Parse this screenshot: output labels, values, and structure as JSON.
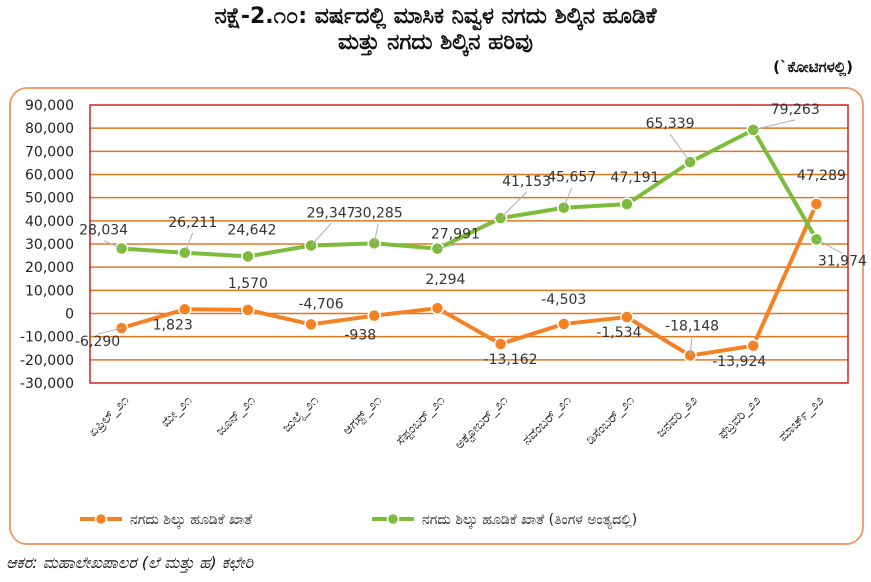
{
  "title_line1": "ನಕ್ಷೆ-2.೧೦: ವರ್ಷದಲ್ಲಿ ಮಾಸಿಕ ನಿವ್ವಳ ನಗದು ಶಿಲ್ಕಿನ ಹೂಡಿಕೆ",
  "title_line2": "ಮತ್ತು ನಗದು ಶಿಲ್ಕಿನ ಹರಿವು",
  "unit_label": "(`ಕೋಟಿಗಳಲ್ಲಿ)",
  "source_note": "ಆಕರ: ಮಹಾಲೇಖಪಾಲರ (ಲೆ ಮತ್ತು ಹ) ಕಛೇರಿ",
  "colors": {
    "series1": "#f48224",
    "series2": "#7dbb3b",
    "grid": "#e07820",
    "plot_border": "#d42020",
    "frame": "#f0a070"
  },
  "chart_data": {
    "type": "line",
    "categories": [
      "ಏಪ್ರಿಲ್_೨೧",
      "ಮೇ_೨೧",
      "ಜೂನ್_೨೧",
      "ಜುಲೈ_೨೧",
      "ಆಗಸ್ಟ್_೨೧",
      "ಸೆಪ್ಟಂಬರ್_೨೧",
      "ಅಕ್ಟೋಬರ್_೨೧",
      "ನವೆಂಬರ್_೨೧",
      "ಡಿಸೆಂಬರ್_೨೧",
      "ಜನವರಿ_೨೨",
      "ಫೆಬ್ರವರಿ_೨೨",
      "ಮಾರ್ಚ್_೨೨"
    ],
    "ylim": [
      -30000,
      90000
    ],
    "yticks": [
      -30000,
      -20000,
      -10000,
      0,
      10000,
      20000,
      30000,
      40000,
      50000,
      60000,
      70000,
      80000,
      90000
    ],
    "ytick_labels": [
      "-30,000",
      "-20,000",
      "-10,000",
      "0",
      "10,000",
      "20,000",
      "30,000",
      "40,000",
      "50,000",
      "60,000",
      "70,000",
      "80,000",
      "90,000"
    ],
    "grid": true,
    "legend_position": "bottom",
    "series": [
      {
        "name": "ನಗದು ಶಿಲ್ಕು ಹೂಡಿಕೆ ಖಾತೆ",
        "values": [
          -6290,
          1823,
          1570,
          -4706,
          -938,
          2294,
          -13162,
          -4503,
          -1534,
          -18148,
          -13924,
          47289
        ],
        "labels": [
          "-6,290",
          "1,823",
          "1,570",
          "-4,706",
          "-938",
          "2,294",
          "-13,162",
          "-4,503",
          "-1,534",
          "-18,148",
          "-13,924",
          "47,289"
        ]
      },
      {
        "name": "ನಗದು ಶಿಲ್ಕು ಹೂಡಿಕೆ ಖಾತೆ (ತಿಂಗಳ ಅಂತ್ಯದಲ್ಲಿ)",
        "values": [
          28034,
          26211,
          24642,
          29347,
          30285,
          27991,
          41153,
          45657,
          47191,
          65339,
          79263,
          31974
        ],
        "labels": [
          "28,034",
          "26,211",
          "24,642",
          "29,347",
          "30,285",
          "27,991",
          "41,153",
          "45,657",
          "47,191",
          "65,339",
          "79,263",
          "31,974"
        ]
      }
    ]
  }
}
